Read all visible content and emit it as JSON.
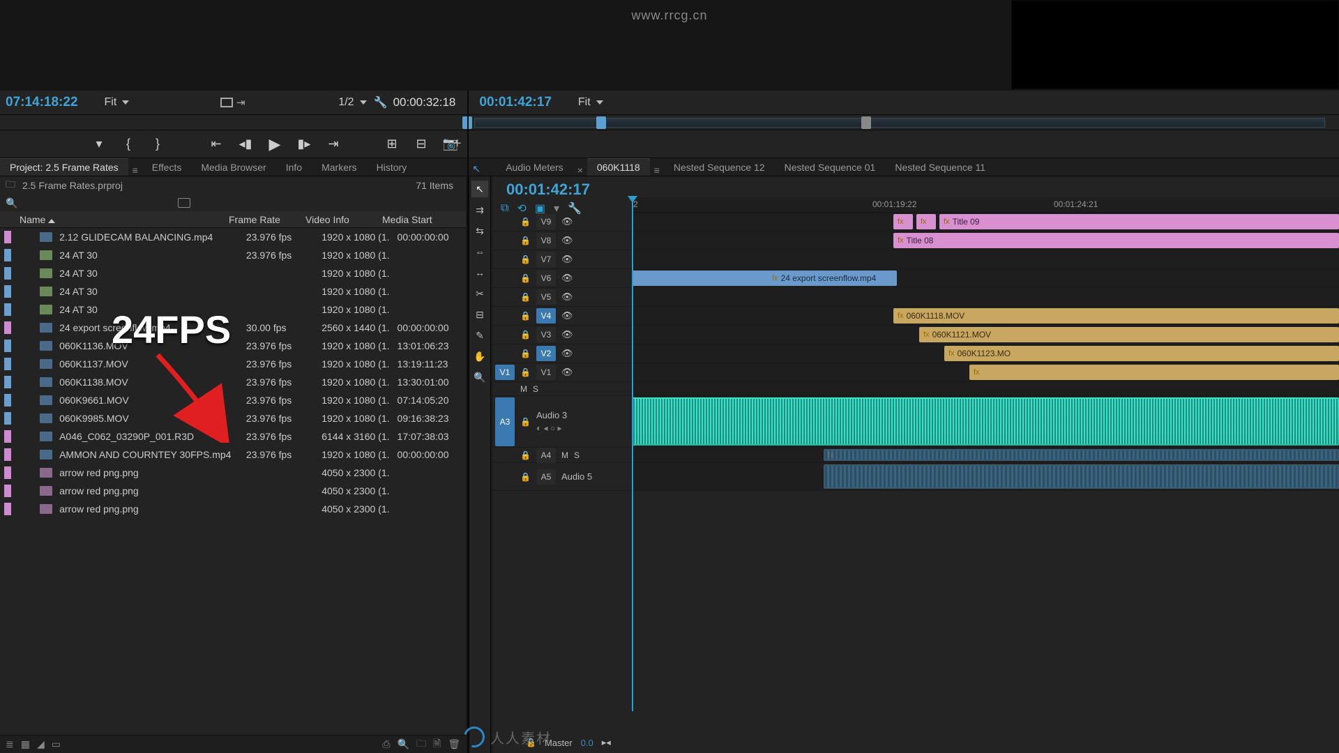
{
  "watermark": {
    "url": "www.rrcg.cn",
    "brand": "人人素材"
  },
  "source": {
    "tc_in": "07:14:18:22",
    "zoom": "Fit",
    "res": "1/2",
    "tc_out": "00:00:32:18"
  },
  "program": {
    "tc_in": "00:01:42:17",
    "zoom": "Fit"
  },
  "tabs_left": {
    "project": "Project: 2.5 Frame Rates",
    "effects": "Effects",
    "media": "Media Browser",
    "info": "Info",
    "markers": "Markers",
    "history": "History"
  },
  "tabs_right": {
    "audio": "Audio Meters",
    "seq0": "060K1118",
    "seq1": "Nested Sequence 12",
    "seq2": "Nested Sequence 01",
    "seq3": "Nested Sequence 11"
  },
  "project": {
    "file": "2.5 Frame Rates.prproj",
    "count": "71 Items",
    "cols": {
      "name": "Name",
      "fr": "Frame Rate",
      "vi": "Video Info",
      "ms": "Media Start"
    },
    "rows": [
      {
        "label": "#d08ad0",
        "type": "vid",
        "name": "2.12 GLIDECAM BALANCING.mp4",
        "fr": "23.976 fps",
        "vi": "1920 x 1080 (1.",
        "ms": "00:00:00:00"
      },
      {
        "label": "#6aa0d0",
        "type": "seq",
        "name": "24 AT 30",
        "fr": "23.976 fps",
        "vi": "1920 x 1080 (1.",
        "ms": ""
      },
      {
        "label": "#6aa0d0",
        "type": "seq",
        "name": "24 AT 30",
        "fr": "",
        "vi": "1920 x 1080 (1.",
        "ms": ""
      },
      {
        "label": "#6aa0d0",
        "type": "seq",
        "name": "24 AT 30",
        "fr": "",
        "vi": "1920 x 1080 (1.",
        "ms": ""
      },
      {
        "label": "#6aa0d0",
        "type": "seq",
        "name": "24 AT 30",
        "fr": "",
        "vi": "1920 x 1080 (1.",
        "ms": ""
      },
      {
        "label": "#d08ad0",
        "type": "vid",
        "name": "24 export screenflow.mp4",
        "fr": "30.00 fps",
        "vi": "2560 x 1440 (1.",
        "ms": "00:00:00:00"
      },
      {
        "label": "#6aa0d0",
        "type": "vid",
        "name": "060K1136.MOV",
        "fr": "23.976 fps",
        "vi": "1920 x 1080 (1.",
        "ms": "13:01:06:23"
      },
      {
        "label": "#6aa0d0",
        "type": "vid",
        "name": "060K1137.MOV",
        "fr": "23.976 fps",
        "vi": "1920 x 1080 (1.",
        "ms": "13:19:11:23"
      },
      {
        "label": "#6aa0d0",
        "type": "vid",
        "name": "060K1138.MOV",
        "fr": "23.976 fps",
        "vi": "1920 x 1080 (1.",
        "ms": "13:30:01:00"
      },
      {
        "label": "#6aa0d0",
        "type": "vid",
        "name": "060K9661.MOV",
        "fr": "23.976 fps",
        "vi": "1920 x 1080 (1.",
        "ms": "07:14:05:20"
      },
      {
        "label": "#6aa0d0",
        "type": "vid",
        "name": "060K9985.MOV",
        "fr": "23.976 fps",
        "vi": "1920 x 1080 (1.",
        "ms": "09:16:38:23"
      },
      {
        "label": "#d08ad0",
        "type": "vid",
        "name": "A046_C062_03290P_001.R3D",
        "fr": "23.976 fps",
        "vi": "6144 x 3160 (1.",
        "ms": "17:07:38:03"
      },
      {
        "label": "#d08ad0",
        "type": "vid",
        "name": "AMMON AND COURNTEY 30FPS.mp4",
        "fr": "23.976 fps",
        "vi": "1920 x 1080 (1.",
        "ms": "00:00:00:00"
      },
      {
        "label": "#d08ad0",
        "type": "img",
        "name": "arrow red png.png",
        "fr": "",
        "vi": "4050 x 2300 (1.",
        "ms": ""
      },
      {
        "label": "#d08ad0",
        "type": "img",
        "name": "arrow red png.png",
        "fr": "",
        "vi": "4050 x 2300 (1.",
        "ms": ""
      },
      {
        "label": "#d08ad0",
        "type": "img",
        "name": "arrow red png.png",
        "fr": "",
        "vi": "4050 x 2300 (1.",
        "ms": ""
      }
    ]
  },
  "overlay": {
    "label": "24FPS"
  },
  "timeline": {
    "tc": "00:01:42:17",
    "ruler": {
      "t1": "00:01:19:22",
      "t2": "00:01:24:21",
      "mark2": "2"
    },
    "v_tracks": [
      {
        "id": "V9"
      },
      {
        "id": "V8"
      },
      {
        "id": "V7"
      },
      {
        "id": "V6"
      },
      {
        "id": "V5"
      },
      {
        "id": "V4",
        "tgt": true
      },
      {
        "id": "V3"
      },
      {
        "id": "V2",
        "tgt": true
      },
      {
        "id": "V1",
        "src": "V1"
      }
    ],
    "a_tracks": [
      {
        "id": "Audio 3",
        "src": "A3",
        "expanded": true
      },
      {
        "id": "A4"
      },
      {
        "id": "Audio 5",
        "lbl": "A5"
      }
    ],
    "clips": {
      "v9a": "Title 09",
      "v8a": "Title 08",
      "v6a": "24 export screenflow.mp4",
      "v4a": "060K1118.MOV",
      "v3a": "060K1121.MOV",
      "v2a": "060K1123.MO"
    },
    "master": {
      "label": "Master",
      "value": "0.0"
    }
  }
}
